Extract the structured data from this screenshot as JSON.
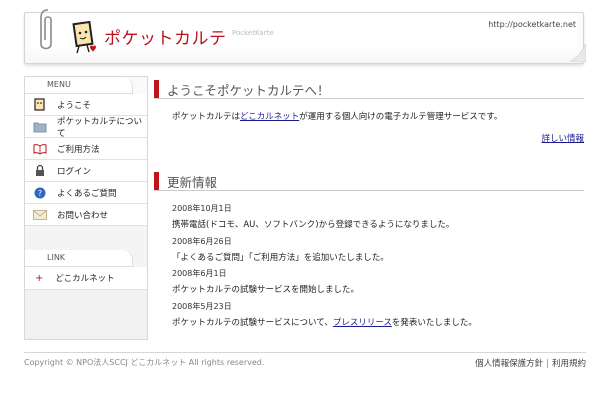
{
  "header": {
    "logo_text": "ポケットカルテ",
    "logo_sub": "PocketKarte",
    "site_url": "http://pocketkarte.net"
  },
  "sidebar": {
    "menu_title": "MENU",
    "items": [
      {
        "label": "ようこそ",
        "icon": "card-icon"
      },
      {
        "label": "ポケットカルテについて",
        "icon": "folder-icon"
      },
      {
        "label": "ご利用方法",
        "icon": "book-icon"
      },
      {
        "label": "ログイン",
        "icon": "lock-icon"
      },
      {
        "label": "よくあるご質問",
        "icon": "question-icon"
      },
      {
        "label": "お問い合わせ",
        "icon": "mail-icon"
      }
    ],
    "link_title": "LINK",
    "links": [
      {
        "label": "どこカルネット"
      }
    ]
  },
  "welcome": {
    "title": "ようこそポケットカルテへ！",
    "text_before": "ポケットカルテは",
    "text_link": "どこカルネット",
    "text_after": "が運用する個人向けの電子カルテ管理サービスです。",
    "more_link": "詳しい情報"
  },
  "news": {
    "title": "更新情報",
    "items": [
      {
        "date": "2008年10月1日",
        "text": "携帯電話(ドコモ、AU、ソフトバンク)から登録できるようになりました。"
      },
      {
        "date": "2008年6月26日",
        "text": "「よくあるご質問」「ご利用方法」を追加いたしました。"
      },
      {
        "date": "2008年6月1日",
        "text": "ポケットカルテの試験サービスを開始しました。"
      },
      {
        "date": "2008年5月23日",
        "text_before": "ポケットカルテの試験サービスについて、",
        "text_link": "プレスリリース",
        "text_after": "を発表いたしました。"
      }
    ]
  },
  "footer": {
    "copyright": "Copyright © NPO法人SCCJ どこカルネット All rights reserved.",
    "privacy": "個人情報保護方針",
    "separator": "|",
    "terms": "利用規約"
  },
  "colors": {
    "accent": "#c0141c",
    "link": "#1a1a8c"
  }
}
